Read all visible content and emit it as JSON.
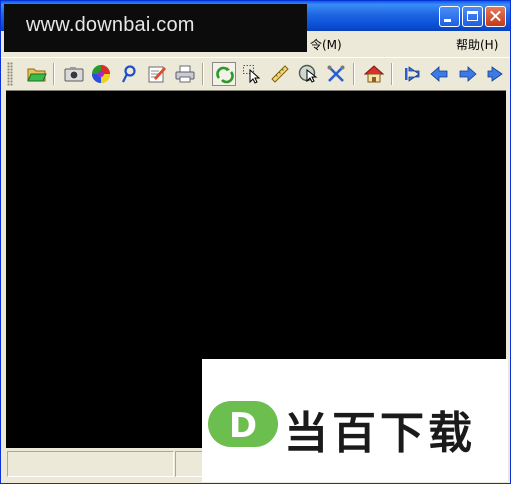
{
  "watermark": {
    "text": "www.downbai.com"
  },
  "menu": {
    "command_label": "令(M)",
    "help_label": "帮助(H)"
  },
  "toolbar": {
    "buttons": [
      {
        "icon": "folder-open-icon"
      },
      {
        "icon": "camera-icon"
      },
      {
        "icon": "color-wheel-icon"
      },
      {
        "icon": "pin-icon"
      },
      {
        "icon": "edit-note-icon"
      },
      {
        "icon": "printer-icon"
      },
      {
        "icon": "refresh-icon",
        "pressed": true
      },
      {
        "icon": "select-pointer-icon"
      },
      {
        "icon": "ruler-icon"
      },
      {
        "icon": "zoom-pointer-icon"
      },
      {
        "icon": "crossed-tools-icon"
      },
      {
        "icon": "home-icon"
      },
      {
        "icon": "first-page-icon"
      },
      {
        "icon": "previous-icon"
      },
      {
        "icon": "next-icon"
      },
      {
        "icon": "last-page-icon"
      }
    ]
  },
  "promo": {
    "brand": "当百下载",
    "logo_letter": "D"
  },
  "colors": {
    "title_bar": "#0b4fd6",
    "canvas": "#000000",
    "chrome": "#ece9d8",
    "brand_green": "#6cbf4e"
  }
}
